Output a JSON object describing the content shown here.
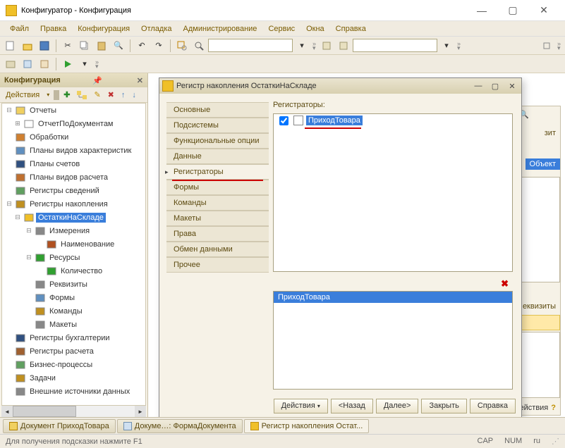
{
  "window": {
    "title": "Конфигуратор - Конфигурация"
  },
  "menu": [
    "Файл",
    "Правка",
    "Конфигурация",
    "Отладка",
    "Администрирование",
    "Сервис",
    "Окна",
    "Справка"
  ],
  "config_panel": {
    "title": "Конфигурация",
    "actions_label": "Действия"
  },
  "tree": [
    {
      "depth": 0,
      "exp": "−",
      "icon": "folder",
      "label": "Отчеты"
    },
    {
      "depth": 1,
      "exp": "+",
      "icon": "doc",
      "label": "ОтчетПоДокументам"
    },
    {
      "depth": 0,
      "exp": "",
      "icon": "process",
      "label": "Обработки"
    },
    {
      "depth": 0,
      "exp": "",
      "icon": "plan",
      "label": "Планы видов характеристик"
    },
    {
      "depth": 0,
      "exp": "",
      "icon": "accounts",
      "label": "Планы счетов"
    },
    {
      "depth": 0,
      "exp": "",
      "icon": "calc",
      "label": "Планы видов расчета"
    },
    {
      "depth": 0,
      "exp": "",
      "icon": "regs",
      "label": "Регистры сведений"
    },
    {
      "depth": 0,
      "exp": "−",
      "icon": "rega",
      "label": "Регистры накопления"
    },
    {
      "depth": 1,
      "exp": "−",
      "icon": "rega-y",
      "label": "ОстаткиНаСкладе",
      "selected": true
    },
    {
      "depth": 2,
      "exp": "−",
      "icon": "dims",
      "label": "Измерения"
    },
    {
      "depth": 3,
      "exp": "",
      "icon": "dim",
      "label": "Наименование"
    },
    {
      "depth": 2,
      "exp": "−",
      "icon": "res",
      "label": "Ресурсы"
    },
    {
      "depth": 3,
      "exp": "",
      "icon": "res-item",
      "label": "Количество"
    },
    {
      "depth": 2,
      "exp": "",
      "icon": "attr",
      "label": "Реквизиты"
    },
    {
      "depth": 2,
      "exp": "",
      "icon": "forms",
      "label": "Формы"
    },
    {
      "depth": 2,
      "exp": "",
      "icon": "cmd",
      "label": "Команды"
    },
    {
      "depth": 2,
      "exp": "",
      "icon": "tmpl",
      "label": "Макеты"
    },
    {
      "depth": 0,
      "exp": "",
      "icon": "regb",
      "label": "Регистры бухгалтерии"
    },
    {
      "depth": 0,
      "exp": "",
      "icon": "regc",
      "label": "Регистры расчета"
    },
    {
      "depth": 0,
      "exp": "",
      "icon": "bp",
      "label": "Бизнес-процессы"
    },
    {
      "depth": 0,
      "exp": "",
      "icon": "task",
      "label": "Задачи"
    },
    {
      "depth": 0,
      "exp": "",
      "icon": "ext",
      "label": "Внешние источники данных"
    }
  ],
  "prop": {
    "title": "Регистр накопления ОстаткиНаСкладе",
    "tabs": [
      "Основные",
      "Подсистемы",
      "Функциональные опции",
      "Данные",
      "Регистраторы",
      "Формы",
      "Команды",
      "Макеты",
      "Права",
      "Обмен данными",
      "Прочее"
    ],
    "active_tab": 4,
    "section_label": "Регистраторы:",
    "registrator_item": "ПриходТовара",
    "selected_item": "ПриходТовара",
    "buttons": {
      "actions": "Действия",
      "back": "<Назад",
      "next": "Далее>",
      "close": "Закрыть",
      "help": "Справка"
    }
  },
  "back_panel": {
    "chip_label": "зит",
    "object_label": "Объект",
    "attr_label": "еквизиты",
    "actions_hint": "ействия",
    "qmark": "?"
  },
  "bottom_tabs": [
    "Документ ПриходТовара",
    "Докуме…: ФормаДокумента",
    "Регистр накопления Остат..."
  ],
  "status": {
    "hint": "Для получения подсказки нажмите F1",
    "cap": "CAP",
    "num": "NUM",
    "lang": "ru"
  }
}
